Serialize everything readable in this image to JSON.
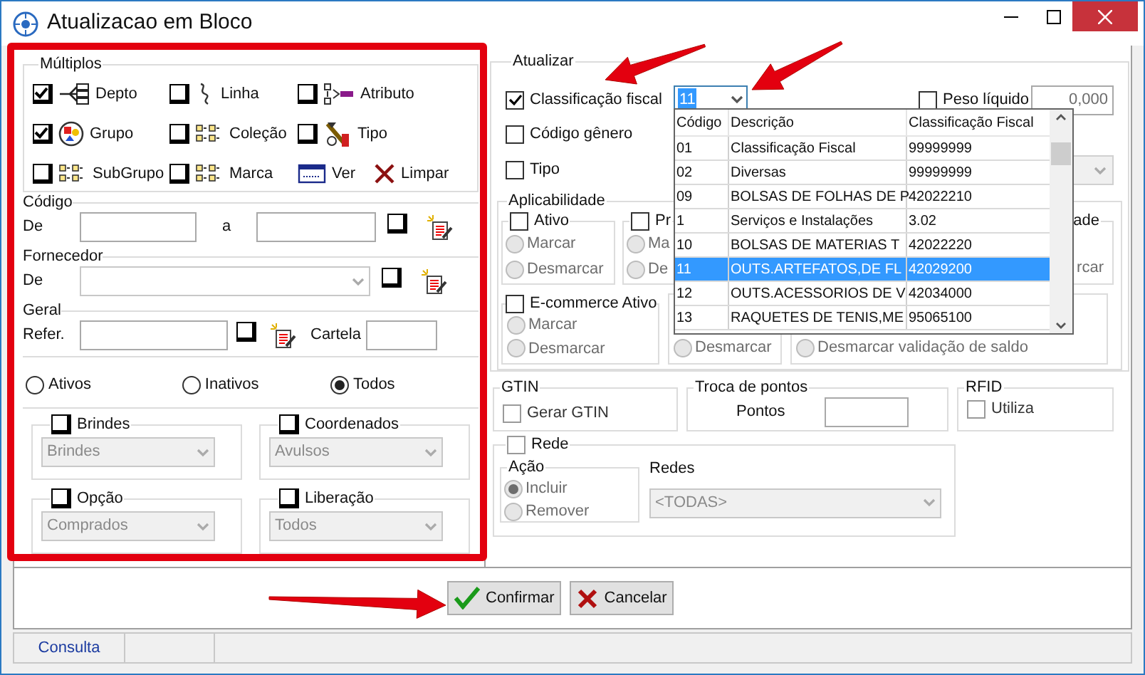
{
  "window": {
    "title": "Atualizacao em Bloco"
  },
  "multiplos": {
    "title": "Múltiplos",
    "items": [
      {
        "kind": "check",
        "label": "Depto",
        "checked": true
      },
      {
        "kind": "check",
        "label": "Linha",
        "checked": false
      },
      {
        "kind": "check",
        "label": "Atributo",
        "checked": false
      },
      {
        "kind": "check",
        "label": "Grupo",
        "checked": true
      },
      {
        "kind": "check",
        "label": "Coleção",
        "checked": false
      },
      {
        "kind": "check",
        "label": "Tipo",
        "checked": false
      },
      {
        "kind": "check",
        "label": "SubGrupo",
        "checked": false
      },
      {
        "kind": "check",
        "label": "Marca",
        "checked": false
      },
      {
        "kind": "button",
        "label": "Ver"
      },
      {
        "kind": "button",
        "label": "Limpar"
      }
    ]
  },
  "codigo": {
    "title": "Código",
    "from_label": "De",
    "to_label": "a",
    "checked": false
  },
  "fornecedor": {
    "title": "Fornecedor",
    "from_label": "De",
    "checked": false
  },
  "geral": {
    "title": "Geral",
    "ref_label": "Refer.",
    "cartela_label": "Cartela",
    "checked": false
  },
  "status_radios": [
    {
      "label": "Ativos",
      "selected": false
    },
    {
      "label": "Inativos",
      "selected": false
    },
    {
      "label": "Todos",
      "selected": true
    }
  ],
  "subgroups": [
    {
      "title": "Brindes",
      "checked": false,
      "value": "Brindes"
    },
    {
      "title": "Coordenados",
      "checked": false,
      "value": "Avulsos"
    },
    {
      "title": "Opção",
      "checked": false,
      "value": "Comprados"
    },
    {
      "title": "Liberação",
      "checked": false,
      "value": "Todos"
    }
  ],
  "atualizar": {
    "title": "Atualizar",
    "classificacao": {
      "label": "Classificação fiscal",
      "checked": true,
      "value": "11"
    },
    "peso": {
      "label": "Peso líquido",
      "checked": false,
      "value": "0,000"
    },
    "codigo_genero": {
      "label": "Código gênero",
      "checked": false
    },
    "tipo": {
      "label": "Tipo",
      "checked": false
    }
  },
  "aplicabilidade": {
    "title": "Aplicabilidade",
    "groups": [
      {
        "title": "Ativo",
        "checked": false,
        "options": [
          {
            "label": "Marcar",
            "selected": false
          },
          {
            "label": "Desmarcar",
            "selected": false
          }
        ]
      },
      {
        "title": "Pr",
        "checked": false,
        "options": [
          {
            "label": "Ma",
            "selected": false
          },
          {
            "label": "De",
            "selected": false
          }
        ]
      },
      {
        "title": "ade",
        "options": [
          {
            "label": "rcar"
          }
        ]
      },
      {
        "title": "E-commerce Ativo",
        "checked": false,
        "options": [
          {
            "label": "Marcar",
            "selected": false
          },
          {
            "label": "Desmarcar",
            "selected": false
          }
        ]
      },
      {
        "options": [
          {
            "label": "Desmarcar",
            "selected": false
          }
        ]
      },
      {
        "options": [
          {
            "label": "Desmarcar validação de saldo",
            "selected": false
          }
        ]
      }
    ]
  },
  "gtin": {
    "title": "GTIN",
    "label": "Gerar GTIN",
    "checked": false
  },
  "troca": {
    "title": "Troca de pontos",
    "label": "Pontos"
  },
  "rfid": {
    "title": "RFID",
    "label": "Utiliza",
    "checked": false
  },
  "rede": {
    "title": "Rede",
    "checked": false,
    "acao_title": "Ação",
    "acao": [
      {
        "label": "Incluir",
        "selected": true
      },
      {
        "label": "Remover",
        "selected": false
      }
    ],
    "redes_label": "Redes",
    "redes_value": "<TODAS>"
  },
  "dropdown": {
    "columns": [
      "Código",
      "Descrição",
      "Classificação Fiscal"
    ],
    "rows": [
      {
        "cells": [
          "01",
          "Classificação Fiscal",
          "99999999"
        ],
        "selected": false
      },
      {
        "cells": [
          "02",
          "Diversas",
          "99999999"
        ],
        "selected": false
      },
      {
        "cells": [
          "09",
          "BOLSAS DE FOLHAS DE P",
          "42022210"
        ],
        "selected": false
      },
      {
        "cells": [
          "1",
          "Serviços e Instalações",
          "3.02"
        ],
        "selected": false
      },
      {
        "cells": [
          "10",
          "BOLSAS DE MATERIAS T",
          "42022220"
        ],
        "selected": false
      },
      {
        "cells": [
          "11",
          "OUTS.ARTEFATOS,DE FL",
          "42029200"
        ],
        "selected": true
      },
      {
        "cells": [
          "12",
          "OUTS.ACESSORIOS DE V",
          "42034000"
        ],
        "selected": false
      },
      {
        "cells": [
          "13",
          "RAQUETES DE TENIS,ME",
          "95065100"
        ],
        "selected": false
      }
    ]
  },
  "buttons": [
    {
      "kind": "confirm",
      "label": "Confirmar"
    },
    {
      "kind": "cancel",
      "label": "Cancelar"
    }
  ],
  "status_bar": {
    "tabs": [
      "Consulta"
    ]
  }
}
